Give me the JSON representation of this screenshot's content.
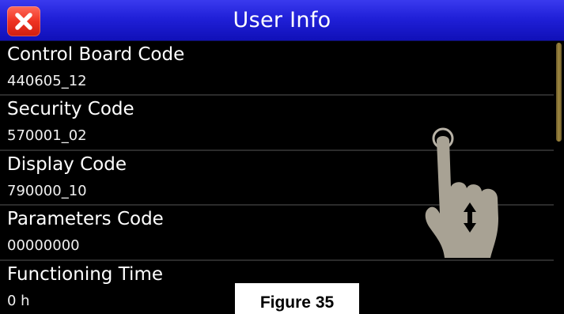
{
  "header": {
    "title": "User Info",
    "close_icon": "close-x-icon",
    "close_color": "#ee3322",
    "background_color": "#2020d8"
  },
  "info_rows": [
    {
      "label": "Control Board Code",
      "value": "440605_12"
    },
    {
      "label": "Security Code",
      "value": "570001_02"
    },
    {
      "label": "Display Code",
      "value": "790000_10"
    },
    {
      "label": "Parameters Code",
      "value": "00000000"
    },
    {
      "label": "Functioning Time",
      "value": "0 h"
    }
  ],
  "gesture_icon": "swipe-vertical-hand-icon",
  "caption": "Figure 35"
}
